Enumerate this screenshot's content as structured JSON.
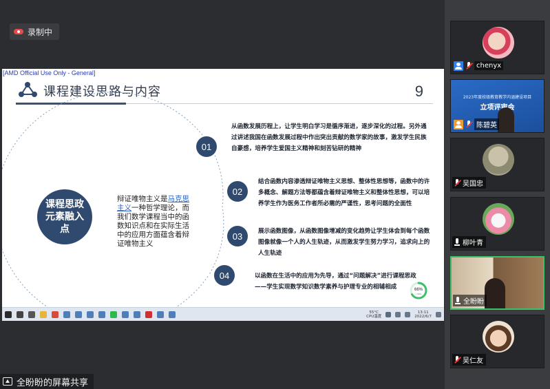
{
  "recording": {
    "label": "录制中"
  },
  "slide": {
    "classification": "[AMD Official Use Only - General]",
    "title": "课程建设思路与内容",
    "page_number": "9",
    "core_label": "课程思政元素融入点",
    "intro_prefix": "辩证唯物主义是",
    "intro_link": "马克思主义",
    "intro_suffix": "一种哲学理论，而我们数学课程当中的函数知识点和在实际生活中的应用方面蕴含着辩证唯物主义",
    "points": [
      {
        "num": "01",
        "text": "从函数发展历程上，让学生明白学习是循序渐进，逐步深化的过程。另外通过讲述我国在函数发展过程中作出突出贡献的数学家的故事，激发学生民族自豪感，培养学生爱国主义精神和刻苦钻研的精神"
      },
      {
        "num": "02",
        "text": "结合函数内容渗透辩证唯物主义思想、整体性思想等，函数中的许多概念、解题方法等都蕴含着辩证唯物主义和整体性思想，可以培养学生作为医务工作者所必需的严谨性，思考问题的全面性"
      },
      {
        "num": "03",
        "text": "展示函数图像，从函数图像增减的变化趋势让学生体会到每个函数图像就像一个人的人生轨迹，从而激发学生努力学习，追求向上的人生轨迹"
      },
      {
        "num": "04",
        "text": "以函数在生活中的应用为先导，通过“问题解决”进行课程思政——学生实现数学知识数学素养与护理专业的相辅相成"
      }
    ],
    "progress": {
      "value": 66,
      "label": "66%",
      "sub": "↑ 0K/s"
    }
  },
  "taskbar": {
    "temp": "55°C",
    "temp_label": "CPU温度",
    "time": "13:11",
    "date": "2022/6/7",
    "icons": [
      "start-icon",
      "search-icon",
      "task-view-icon",
      "file-explorer-icon",
      "chrome-icon",
      "app-icon",
      "app-icon",
      "app-icon",
      "app-icon",
      "wechat-icon",
      "app-icon",
      "app-icon",
      "wps-icon",
      "app-icon",
      "app-icon"
    ]
  },
  "share": {
    "label": "全盼盼的屏幕共享"
  },
  "participants": [
    {
      "name": "chenyx",
      "badge": "host"
    },
    {
      "name": "陈碧英",
      "badge": "host",
      "banner_sub": "2023年度校级教育教学内涵建设项目",
      "banner_title": "立项评审会"
    },
    {
      "name": "吴国忠",
      "badge": "mic-off"
    },
    {
      "name": "柳叶青",
      "badge": "mic-on"
    },
    {
      "name": "全盼盼",
      "badge": "mic-on"
    },
    {
      "name": "吴仁友",
      "badge": "mic-off"
    }
  ],
  "colors": {
    "slide_accent": "#2f4a6e",
    "active_border": "#3cc06a",
    "progress": "#3cc06a"
  }
}
